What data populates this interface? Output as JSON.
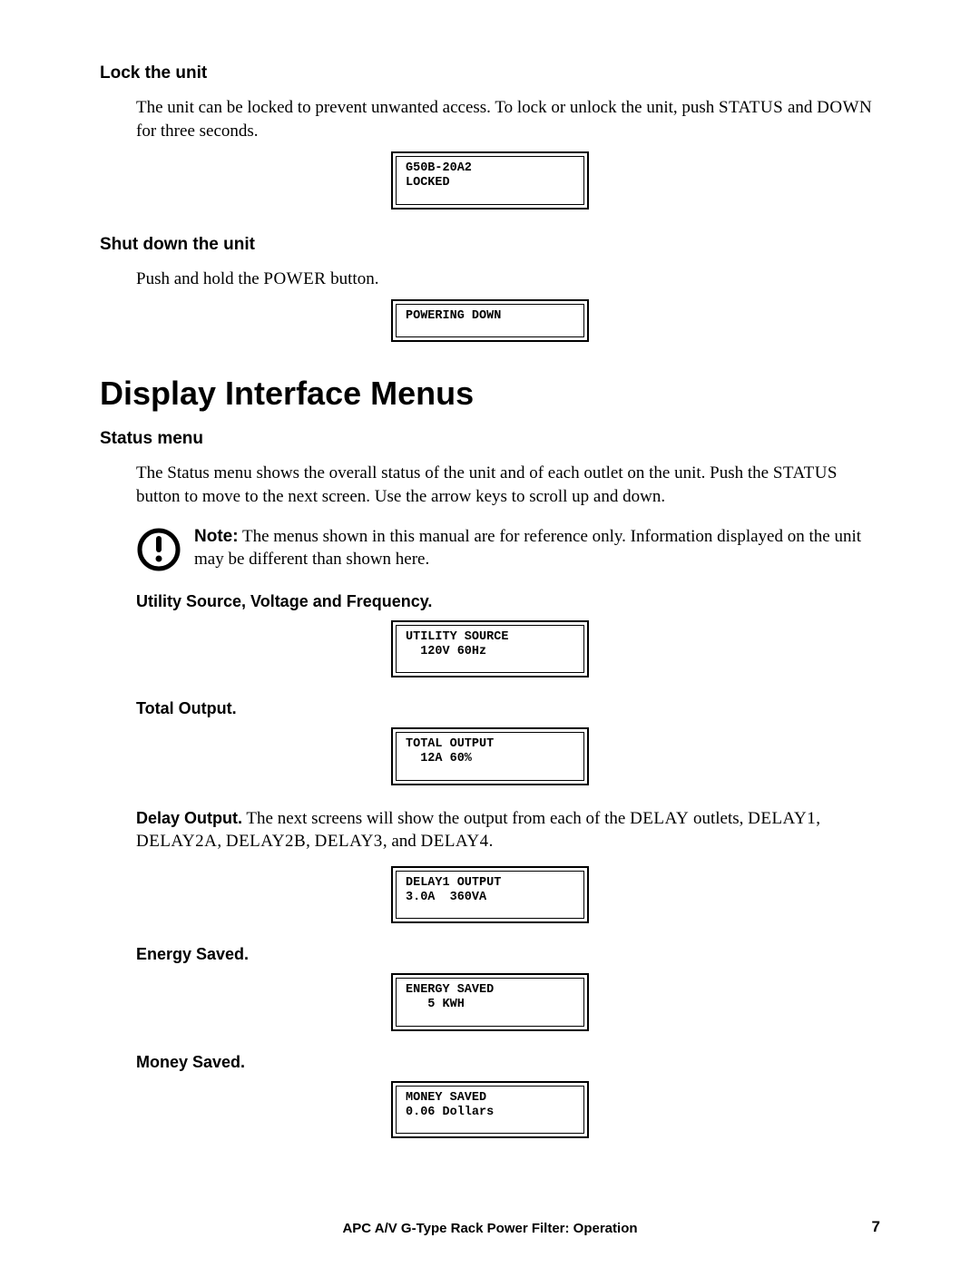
{
  "sections": {
    "lock": {
      "heading": "Lock the unit",
      "body_pre": "The unit can be locked to prevent unwanted access. To lock or unlock the unit, push ",
      "body_sc1": "STATUS",
      "body_mid": " and ",
      "body_sc2": "DOWN",
      "body_post": " for three seconds.",
      "lcd": "G50B-20A2\nLOCKED"
    },
    "shutdown": {
      "heading": "Shut down the unit",
      "body_pre": "Push and hold the ",
      "body_sc1": "POWER",
      "body_post": " button.",
      "lcd": "POWERING DOWN"
    },
    "main_heading": "Display Interface Menus",
    "status_menu": {
      "heading": "Status menu",
      "body_pre": "The Status menu shows the overall status of the unit and of each outlet on the unit. Push the ",
      "body_sc1": "STATUS",
      "body_post": " button to move to the next screen. Use the arrow keys to scroll up and down.",
      "note_label": "Note:",
      "note_body": " The menus shown in this manual are for reference only. Information displayed on the unit may be different than shown here."
    },
    "utility": {
      "heading": "Utility Source, Voltage and Frequency.",
      "lcd": "UTILITY SOURCE\n  120V 60Hz"
    },
    "total_output": {
      "heading": "Total Output.",
      "lcd": "TOTAL OUTPUT\n  12A 60%"
    },
    "delay_output": {
      "heading": "Delay Output.",
      "body_pre": " The next screens will show the output from each of the ",
      "body_sc1": "DELAY",
      "body_mid1": " outlets, ",
      "body_sc2": "DELAY1",
      "body_mid2": ", ",
      "body_sc3": "DELAY2A",
      "body_mid3": ", ",
      "body_sc4": "DELAY2B",
      "body_mid4": ", ",
      "body_sc5": "DELAY3",
      "body_mid5": ", and ",
      "body_sc6": "DELAY4",
      "body_post": ".",
      "lcd": "DELAY1 OUTPUT\n3.0A  360VA"
    },
    "energy_saved": {
      "heading": "Energy Saved.",
      "lcd": "ENERGY SAVED\n   5 KWH"
    },
    "money_saved": {
      "heading": "Money Saved.",
      "lcd": "MONEY SAVED\n0.06 Dollars"
    }
  },
  "footer": "APC A/V G-Type Rack Power Filter: Operation",
  "page_number": "7"
}
